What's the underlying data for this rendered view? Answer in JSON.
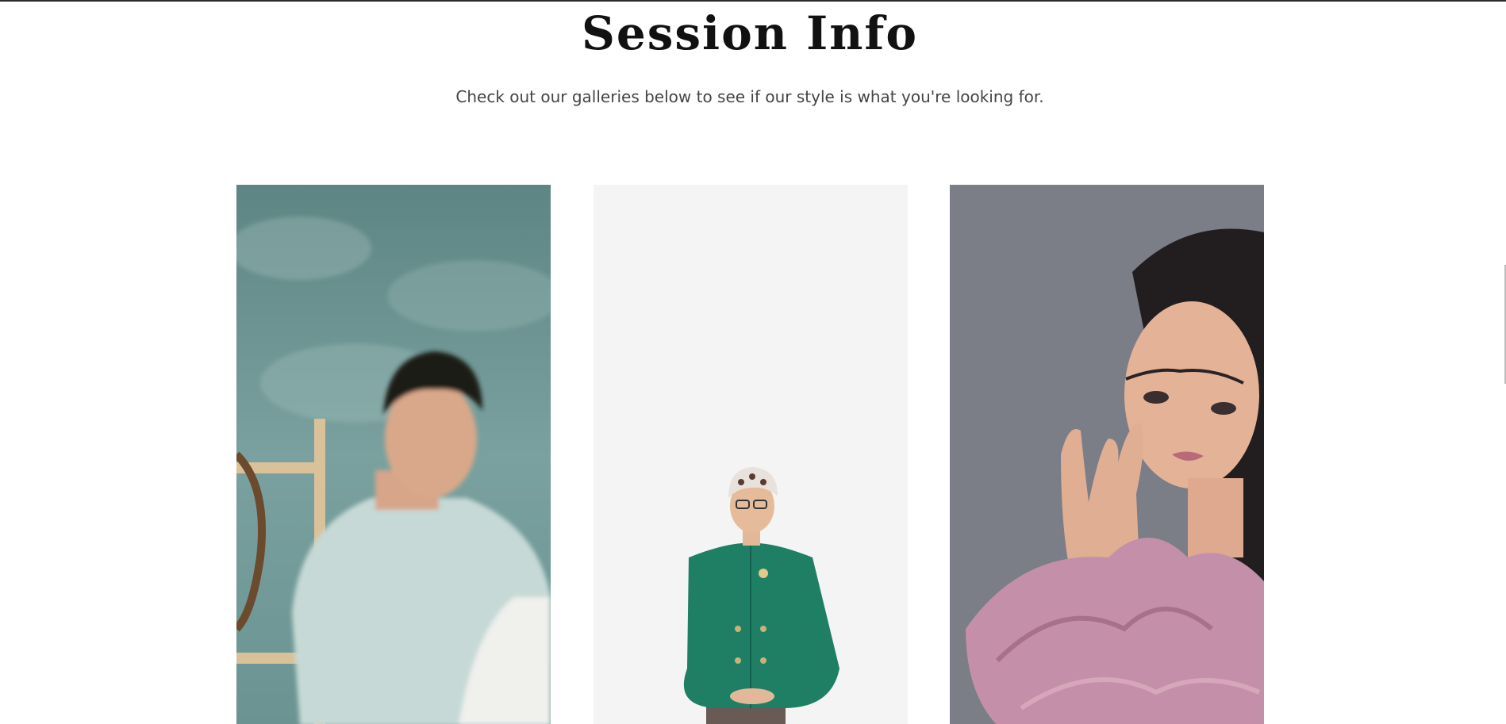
{
  "header": {
    "title": "Session Info",
    "subtitle": "Check out our galleries below to see if our style is what you're looking for."
  },
  "galleries": [
    {
      "label": "portrait-man-shirt",
      "background": "#6f9593"
    },
    {
      "label": "portrait-man-green-jacket",
      "background": "#f5f5f5"
    },
    {
      "label": "portrait-woman-pink",
      "background": "#7c7e88"
    }
  ],
  "colors": {
    "background": "#ffffff",
    "title": "#111111",
    "subtitle": "#444444"
  }
}
